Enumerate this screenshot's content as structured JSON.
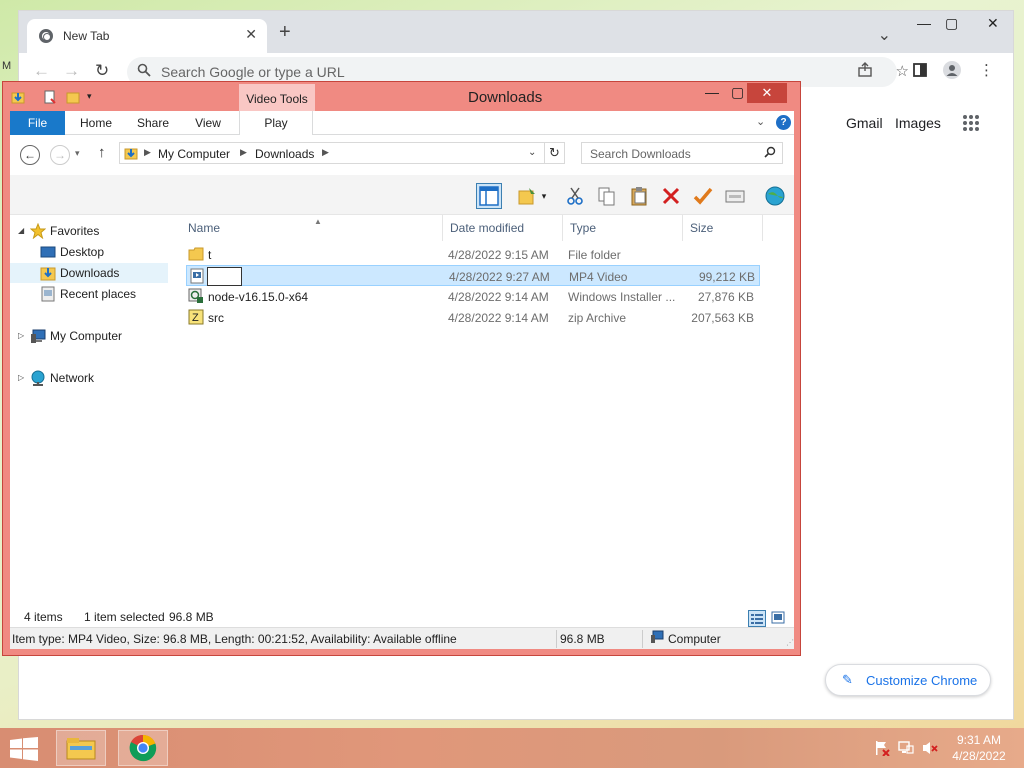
{
  "desktop": {
    "glyph": "M"
  },
  "chrome": {
    "tab_title": "New Tab",
    "tab_close": "✕",
    "new_tab": "+",
    "tab_search": "⌄",
    "window_controls": {
      "minimize": "—",
      "maximize": "▢",
      "close": "✕"
    },
    "omnibox_placeholder": "Search Google or type a URL",
    "links": {
      "gmail": "Gmail",
      "images": "Images"
    },
    "customize_label": "Customize Chrome"
  },
  "explorer": {
    "title": "Downloads",
    "context_tab": "Video Tools",
    "window_controls": {
      "minimize": "—",
      "maximize": "▢",
      "close": "✕"
    },
    "ribbon_tabs": [
      "File",
      "Home",
      "Share",
      "View",
      "Play"
    ],
    "help": "?",
    "breadcrumb": [
      "My Computer",
      "Downloads"
    ],
    "search_placeholder": "Search Downloads",
    "nav": {
      "favorites": "Favorites",
      "desktop": "Desktop",
      "downloads": "Downloads",
      "recent": "Recent places",
      "computer": "My Computer",
      "network": "Network"
    },
    "columns": {
      "name": "Name",
      "date": "Date modified",
      "type": "Type",
      "size": "Size"
    },
    "files": [
      {
        "name": "t",
        "date": "4/28/2022 9:15 AM",
        "type": "File folder",
        "size": ""
      },
      {
        "name": "",
        "date": "4/28/2022 9:27 AM",
        "type": "MP4 Video",
        "size": "99,212 KB"
      },
      {
        "name": "node-v16.15.0-x64",
        "date": "4/28/2022 9:14 AM",
        "type": "Windows Installer ...",
        "size": "27,876 KB"
      },
      {
        "name": "src",
        "date": "4/28/2022 9:14 AM",
        "type": "zip Archive",
        "size": "207,563 KB"
      }
    ],
    "status": {
      "items": "4 items",
      "selected": "1 item selected",
      "selected_size": "96.8 MB"
    },
    "details": {
      "info": "Item type: MP4 Video, Size: 96.8 MB, Length: 00:21:52, Availability: Available offline",
      "size": "96.8 MB",
      "location": "Computer"
    }
  },
  "taskbar": {
    "time": "9:31 AM",
    "date": "4/28/2022"
  },
  "colors": {
    "explorer_frame": "#f08a82",
    "explorer_close": "#c7453c",
    "file_tab": "#1979ca",
    "selection": "#cce8ff",
    "chrome_accent": "#1a73e8"
  }
}
